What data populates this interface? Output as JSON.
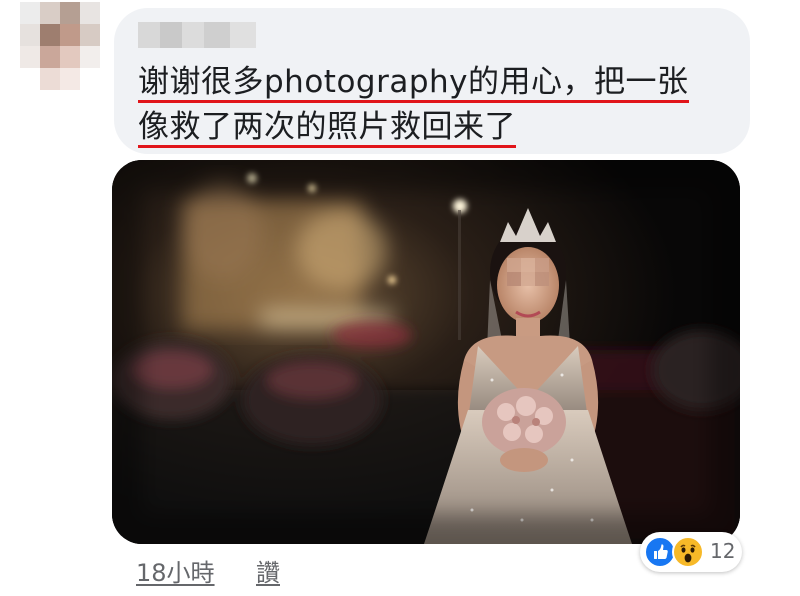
{
  "comment": {
    "author_name": "",
    "lines": [
      "谢谢很多photography的用心，把一张",
      "像救了两次的照片救回来了"
    ],
    "highlight_color": "#e1151a",
    "bubble_color": "#f0f2f5"
  },
  "photo": {
    "icon": "wedding-photo-bride"
  },
  "footer": {
    "timestamp": "18小時",
    "like_label": "讚"
  },
  "reactions": {
    "icons": [
      "like-icon",
      "wow-icon"
    ],
    "count": "12",
    "like_color": "#1877f2",
    "wow_color": "#f7b928"
  }
}
